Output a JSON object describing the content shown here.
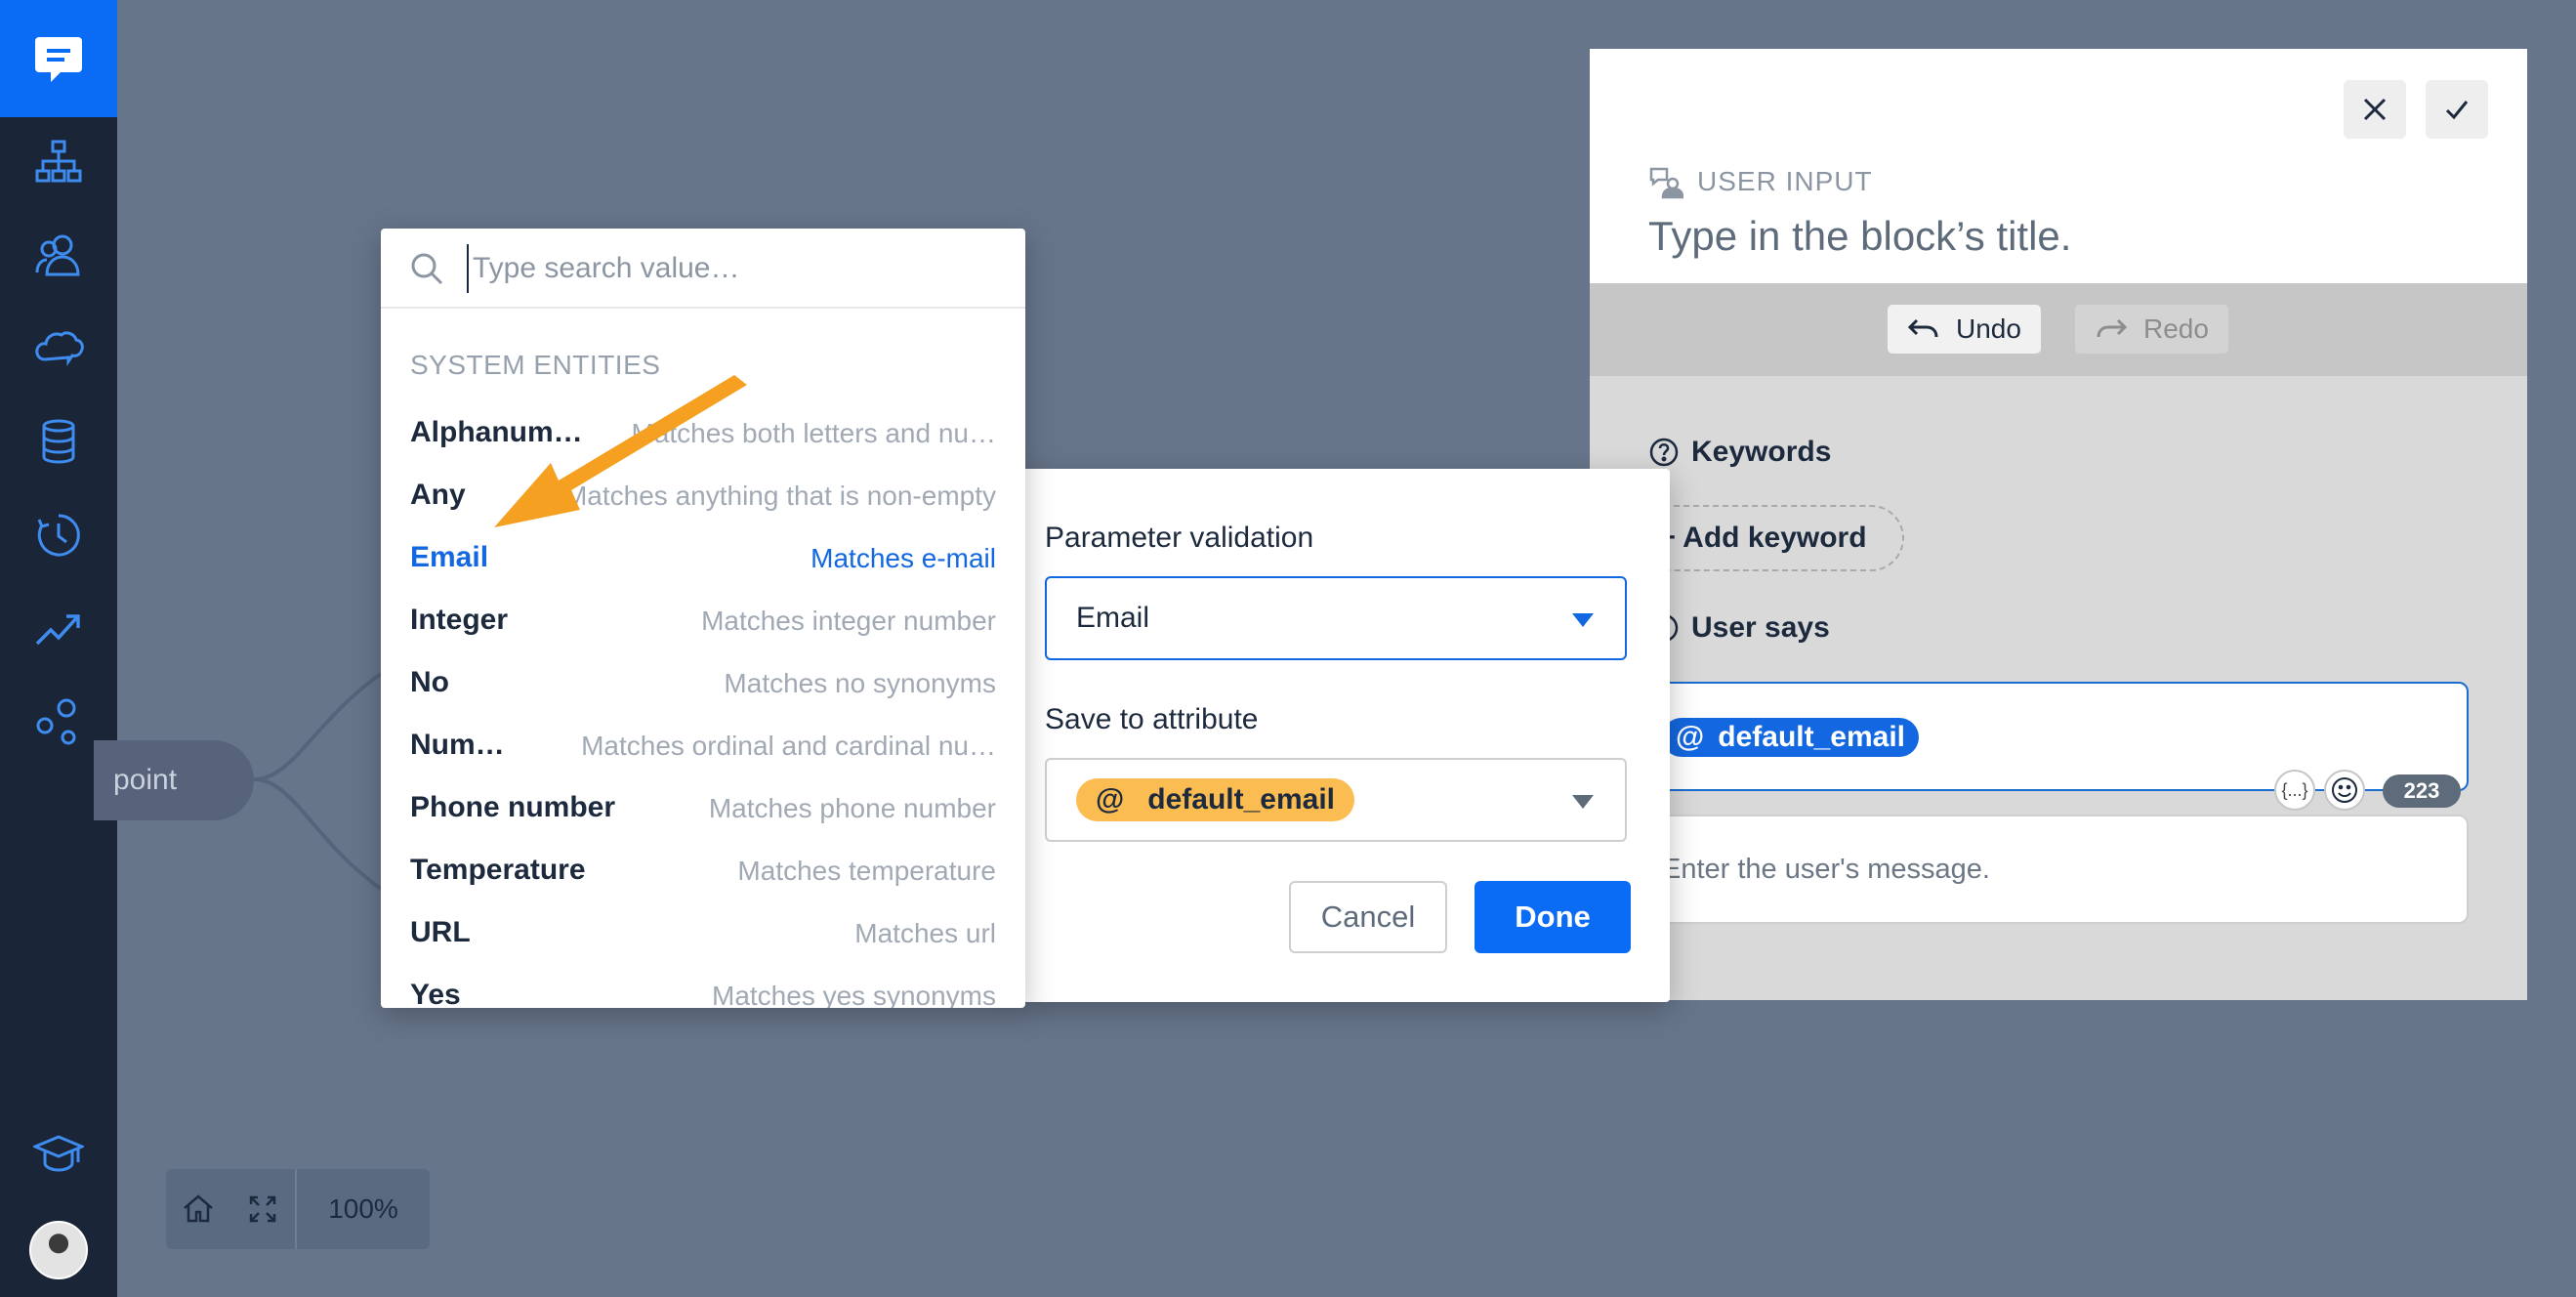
{
  "accent_color": "#0a6bf5",
  "sidebar": {
    "items": [
      {
        "icon": "hierarchy-icon"
      },
      {
        "icon": "users-icon"
      },
      {
        "icon": "cloud-chat-icon"
      },
      {
        "icon": "database-icon"
      },
      {
        "icon": "history-clock-icon"
      },
      {
        "icon": "trending-chart-icon"
      },
      {
        "icon": "integrations-icon"
      },
      {
        "icon": "graduation-cap-icon"
      }
    ]
  },
  "canvas": {
    "node_label": "point",
    "zoom_level": "100%"
  },
  "entity_dropdown": {
    "search_placeholder": "Type search value…",
    "group_title": "SYSTEM ENTITIES",
    "entities": [
      {
        "name": "Alphanum…",
        "desc": "Matches both letters and nu…"
      },
      {
        "name": "Any",
        "desc": "Matches anything that is non-empty"
      },
      {
        "name": "Email",
        "desc": "Matches e-mail"
      },
      {
        "name": "Integer",
        "desc": "Matches integer number"
      },
      {
        "name": "No",
        "desc": "Matches no synonyms"
      },
      {
        "name": "Num…",
        "desc": "Matches ordinal and cardinal nu…"
      },
      {
        "name": "Phone number",
        "desc": "Matches phone number"
      },
      {
        "name": "Temperature",
        "desc": "Matches temperature"
      },
      {
        "name": "URL",
        "desc": "Matches url"
      },
      {
        "name": "Yes",
        "desc": "Matches yes synonyms"
      }
    ],
    "selected": "Email"
  },
  "validation_dialog": {
    "validation_label": "Parameter validation",
    "validation_value": "Email",
    "attribute_label": "Save to attribute",
    "attribute_symbol": "@",
    "attribute_value": "default_email",
    "cancel_label": "Cancel",
    "done_label": "Done"
  },
  "block_panel": {
    "kind": "USER INPUT",
    "title_placeholder": "Type in the block’s title.",
    "undo_label": "Undo",
    "redo_label": "Redo",
    "keywords_label": "Keywords",
    "add_keyword_label": "+ Add keyword",
    "user_says_label": "User says",
    "user_says_chip_symbol": "@",
    "user_says_chip": "default_email",
    "variables_label": "{...}",
    "char_count": "223",
    "message_placeholder": "Enter the user's message."
  }
}
